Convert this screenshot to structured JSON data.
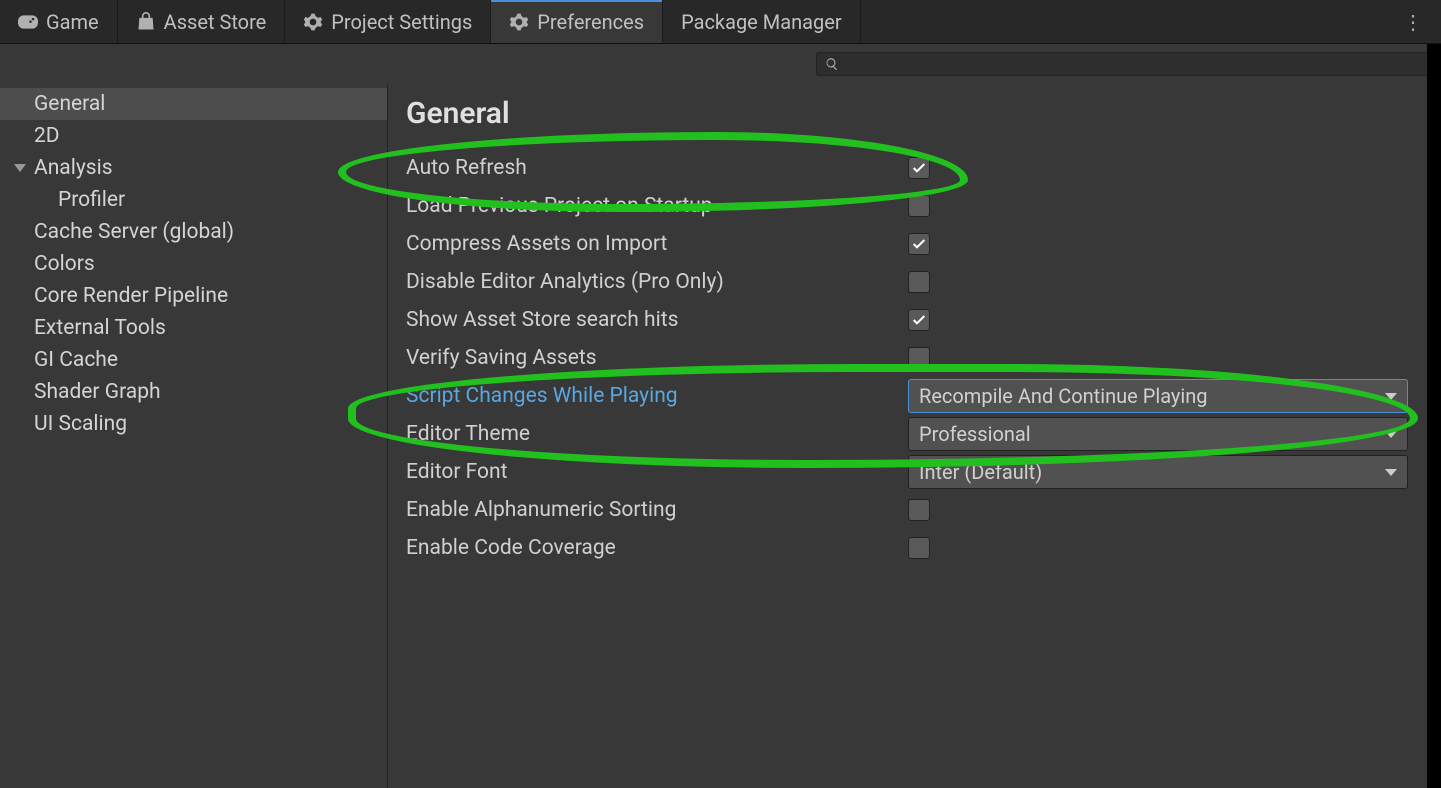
{
  "tabs": [
    {
      "label": "Game",
      "icon": "gamepad"
    },
    {
      "label": "Asset Store",
      "icon": "bag"
    },
    {
      "label": "Project Settings",
      "icon": "gear"
    },
    {
      "label": "Preferences",
      "icon": "gear"
    },
    {
      "label": "Package Manager",
      "icon": ""
    }
  ],
  "active_tab_index": 3,
  "search_placeholder": "",
  "sidebar": {
    "items": [
      {
        "label": "General",
        "selected": true
      },
      {
        "label": "2D"
      },
      {
        "label": "Analysis",
        "expandable": true
      },
      {
        "label": "Profiler",
        "child": true
      },
      {
        "label": "Cache Server (global)"
      },
      {
        "label": "Colors"
      },
      {
        "label": "Core Render Pipeline"
      },
      {
        "label": "External Tools"
      },
      {
        "label": "GI Cache"
      },
      {
        "label": "Shader Graph"
      },
      {
        "label": "UI Scaling"
      }
    ]
  },
  "section_title": "General",
  "rows": [
    {
      "label": "Auto Refresh",
      "type": "checkbox",
      "checked": true
    },
    {
      "label": "Load Previous Project on Startup",
      "type": "checkbox",
      "checked": false
    },
    {
      "label": "Compress Assets on Import",
      "type": "checkbox",
      "checked": true
    },
    {
      "label": "Disable Editor Analytics (Pro Only)",
      "type": "checkbox",
      "checked": false
    },
    {
      "label": "Show Asset Store search hits",
      "type": "checkbox",
      "checked": true
    },
    {
      "label": "Verify Saving Assets",
      "type": "checkbox",
      "checked": false
    },
    {
      "label": "Script Changes While Playing",
      "type": "select",
      "value": "Recompile And Continue Playing",
      "highlight": true,
      "focused": true
    },
    {
      "label": "Editor Theme",
      "type": "select",
      "value": "Professional"
    },
    {
      "label": "Editor Font",
      "type": "select",
      "value": "Inter (Default)"
    },
    {
      "label": "Enable Alphanumeric Sorting",
      "type": "checkbox",
      "checked": false
    },
    {
      "label": "Enable Code Coverage",
      "type": "checkbox",
      "checked": false
    }
  ],
  "annotation_color": "#22c01f"
}
